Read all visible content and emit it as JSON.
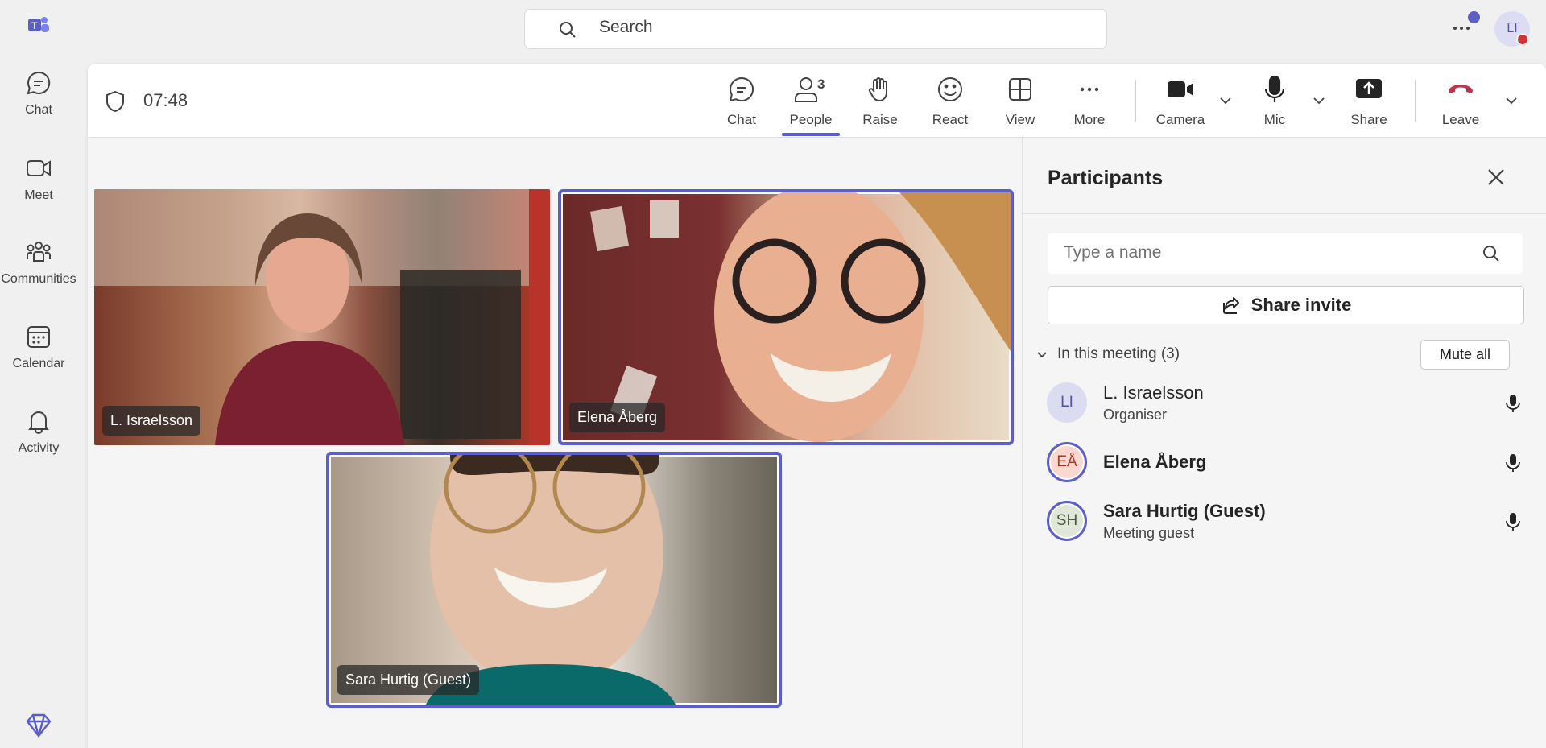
{
  "rail": {
    "items": [
      {
        "label": "Chat",
        "icon": "chat-icon"
      },
      {
        "label": "Meet",
        "icon": "video-icon"
      },
      {
        "label": "Communities",
        "icon": "communities-icon"
      },
      {
        "label": "Calendar",
        "icon": "calendar-icon"
      },
      {
        "label": "Activity",
        "icon": "bell-icon"
      }
    ]
  },
  "topbar": {
    "search_placeholder": "Search",
    "user_initials": "LI"
  },
  "meeting": {
    "elapsed": "07:48",
    "controls": {
      "chat": "Chat",
      "people": "People",
      "people_count": "3",
      "raise": "Raise",
      "react": "React",
      "view": "View",
      "more": "More",
      "camera": "Camera",
      "mic": "Mic",
      "share": "Share",
      "leave": "Leave"
    },
    "tiles": [
      {
        "name": "L. Israelsson"
      },
      {
        "name": "Elena Åberg"
      },
      {
        "name": "Sara Hurtig (Guest)"
      }
    ]
  },
  "panel": {
    "title": "Participants",
    "find_placeholder": "Type a name",
    "share_invite": "Share invite",
    "section_label": "In this meeting (3)",
    "mute_all": "Mute all",
    "participants": [
      {
        "initials": "LI",
        "name": "L. Israelsson",
        "role": "Organiser"
      },
      {
        "initials": "EÅ",
        "name": "Elena Åberg",
        "role": ""
      },
      {
        "initials": "SH",
        "name": "Sara Hurtig (Guest)",
        "role": "Meeting guest"
      }
    ]
  },
  "colors": {
    "accent": "#5b5fc7",
    "leave_red": "#c4314b",
    "presence_busy": "#d13438"
  }
}
